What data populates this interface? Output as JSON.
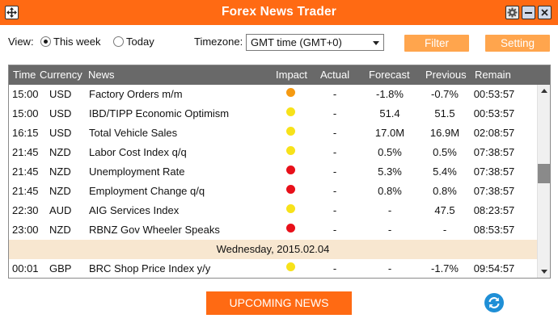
{
  "window": {
    "title": "Forex News Trader"
  },
  "controls": {
    "view_label": "View:",
    "view_options": [
      {
        "label": "This week",
        "checked": true
      },
      {
        "label": "Today",
        "checked": false
      }
    ],
    "timezone_label": "Timezone:",
    "timezone_value": "GMT time (GMT+0)",
    "filter_label": "Filter",
    "setting_label": "Setting"
  },
  "table": {
    "headers": [
      "Time",
      "Currency",
      "News",
      "Impact",
      "Actual",
      "Forecast",
      "Previous",
      "Remain"
    ],
    "rows": [
      {
        "type": "event",
        "time": "15:00",
        "currency": "USD",
        "news": "Factory Orders m/m",
        "impact": "orange",
        "actual": "-",
        "forecast": "-1.8%",
        "previous": "-0.7%",
        "remain": "00:53:57"
      },
      {
        "type": "event",
        "time": "15:00",
        "currency": "USD",
        "news": "IBD/TIPP Economic Optimism",
        "impact": "yellow",
        "actual": "-",
        "forecast": "51.4",
        "previous": "51.5",
        "remain": "00:53:57"
      },
      {
        "type": "event",
        "time": "16:15",
        "currency": "USD",
        "news": "Total Vehicle Sales",
        "impact": "yellow",
        "actual": "-",
        "forecast": "17.0M",
        "previous": "16.9M",
        "remain": "02:08:57"
      },
      {
        "type": "event",
        "time": "21:45",
        "currency": "NZD",
        "news": "Labor Cost Index q/q",
        "impact": "yellow",
        "actual": "-",
        "forecast": "0.5%",
        "previous": "0.5%",
        "remain": "07:38:57"
      },
      {
        "type": "event",
        "time": "21:45",
        "currency": "NZD",
        "news": "Unemployment Rate",
        "impact": "red",
        "actual": "-",
        "forecast": "5.3%",
        "previous": "5.4%",
        "remain": "07:38:57"
      },
      {
        "type": "event",
        "time": "21:45",
        "currency": "NZD",
        "news": "Employment Change q/q",
        "impact": "red",
        "actual": "-",
        "forecast": "0.8%",
        "previous": "0.8%",
        "remain": "07:38:57"
      },
      {
        "type": "event",
        "time": "22:30",
        "currency": "AUD",
        "news": "AIG Services Index",
        "impact": "yellow",
        "actual": "-",
        "forecast": "-",
        "previous": "47.5",
        "remain": "08:23:57"
      },
      {
        "type": "event",
        "time": "23:00",
        "currency": "NZD",
        "news": "RBNZ Gov Wheeler Speaks",
        "impact": "red",
        "actual": "-",
        "forecast": "-",
        "previous": "-",
        "remain": "08:53:57"
      },
      {
        "type": "date",
        "label": "Wednesday, 2015.02.04"
      },
      {
        "type": "event",
        "time": "00:01",
        "currency": "GBP",
        "news": "BRC Shop Price Index y/y",
        "impact": "yellow",
        "actual": "-",
        "forecast": "-",
        "previous": "-1.7%",
        "remain": "09:54:57"
      }
    ]
  },
  "impact_colors": {
    "orange": "#f59a12",
    "yellow": "#f7e21a",
    "red": "#e8101a"
  },
  "upcoming_label": "UPCOMING NEWS",
  "icons": {
    "move": "move-icon",
    "settings": "gear-icon",
    "minimize": "minimize-icon",
    "close": "close-icon",
    "refresh": "refresh-icon"
  },
  "colors": {
    "accent": "#ff6a13",
    "button_light": "#ffa54d",
    "header_bg": "#696969",
    "date_row_bg": "#f8e7d0"
  }
}
